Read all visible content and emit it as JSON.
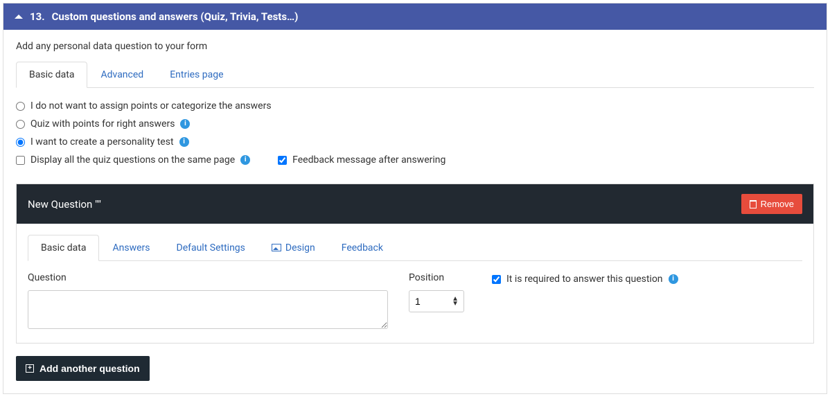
{
  "header": {
    "number": "13.",
    "title": "Custom questions and answers (Quiz, Trivia, Tests…)"
  },
  "intro": "Add any personal data question to your form",
  "outerTabs": {
    "basic": "Basic data",
    "advanced": "Advanced",
    "entries": "Entries page"
  },
  "modeOptions": {
    "none": "I do not want to assign points or categorize the answers",
    "quiz": "Quiz with points for right answers",
    "personality": "I want to create a personality test"
  },
  "checkboxes": {
    "samePage": "Display all the quiz questions on the same page",
    "feedback": "Feedback message after answering"
  },
  "question": {
    "heading": "New Question \"\"",
    "removeLabel": "Remove",
    "innerTabs": {
      "basic": "Basic data",
      "answers": "Answers",
      "defaults": "Default Settings",
      "design": "Design",
      "feedback": "Feedback"
    },
    "fields": {
      "questionLabel": "Question",
      "questionValue": "",
      "positionLabel": "Position",
      "positionValue": "1",
      "requiredLabel": "It is required to answer this question"
    }
  },
  "addButton": "Add another question"
}
